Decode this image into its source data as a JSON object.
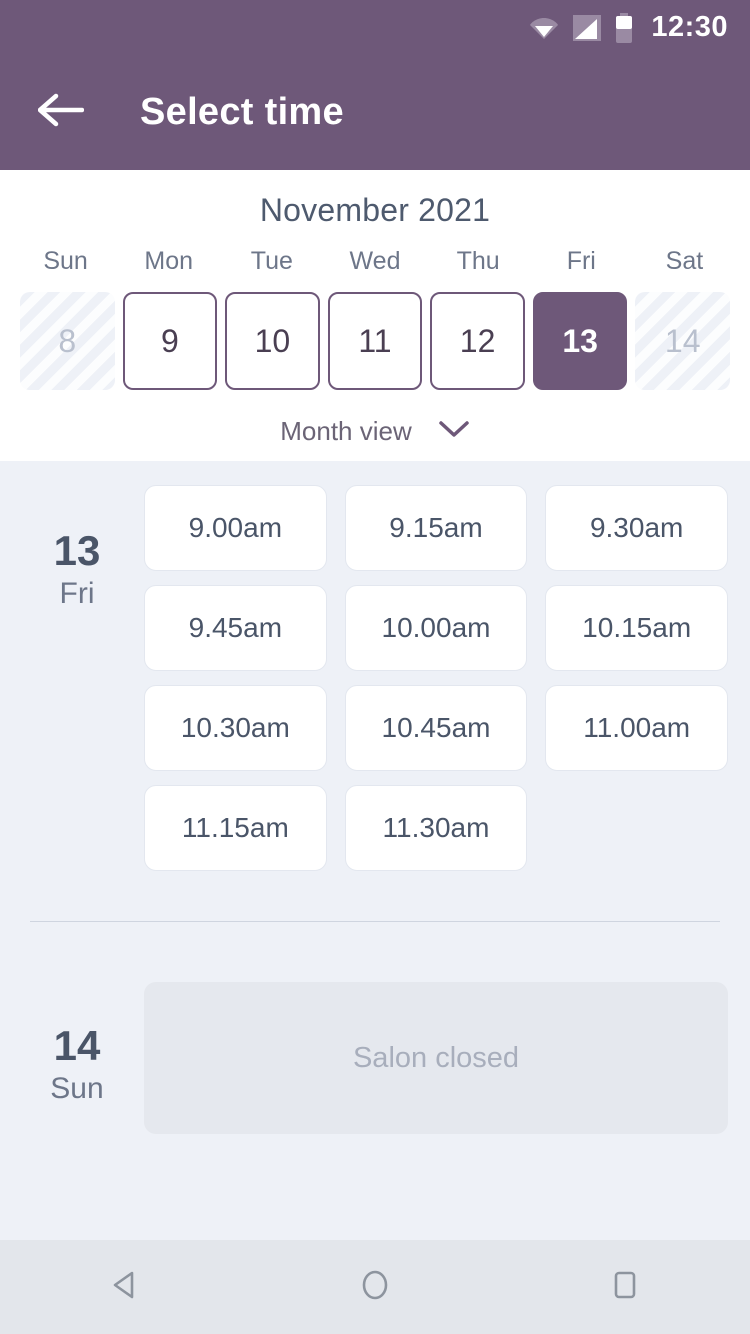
{
  "statusbar": {
    "time": "12:30",
    "icons": [
      "wifi-icon",
      "signal-icon",
      "battery-icon"
    ]
  },
  "appbar": {
    "title": "Select time",
    "back_icon": "arrow-left-icon"
  },
  "calendar": {
    "month_title": "November 2021",
    "weekdays": [
      "Sun",
      "Mon",
      "Tue",
      "Wed",
      "Thu",
      "Fri",
      "Sat"
    ],
    "dates": [
      {
        "num": "8",
        "state": "disabled"
      },
      {
        "num": "9",
        "state": "enabled"
      },
      {
        "num": "10",
        "state": "enabled"
      },
      {
        "num": "11",
        "state": "enabled"
      },
      {
        "num": "12",
        "state": "enabled"
      },
      {
        "num": "13",
        "state": "selected"
      },
      {
        "num": "14",
        "state": "disabled"
      }
    ],
    "view_toggle_label": "Month view",
    "view_toggle_icon": "chevron-down-icon"
  },
  "schedule": [
    {
      "day_number": "13",
      "day_name": "Fri",
      "slots": [
        "9.00am",
        "9.15am",
        "9.30am",
        "9.45am",
        "10.00am",
        "10.15am",
        "10.30am",
        "10.45am",
        "11.00am",
        "11.15am",
        "11.30am"
      ]
    },
    {
      "day_number": "14",
      "day_name": "Sun",
      "closed_label": "Salon closed"
    }
  ],
  "navbar": {
    "back_label": "back-triangle-icon",
    "home_label": "home-circle-icon",
    "recents_label": "recents-square-icon"
  },
  "colors": {
    "brand_purple": "#6e5879",
    "page_background": "#eef1f7",
    "card_white": "#ffffff",
    "text_slate": "#4a5568",
    "muted_text": "#6d7689",
    "closed_box": "#e5e8ee"
  }
}
